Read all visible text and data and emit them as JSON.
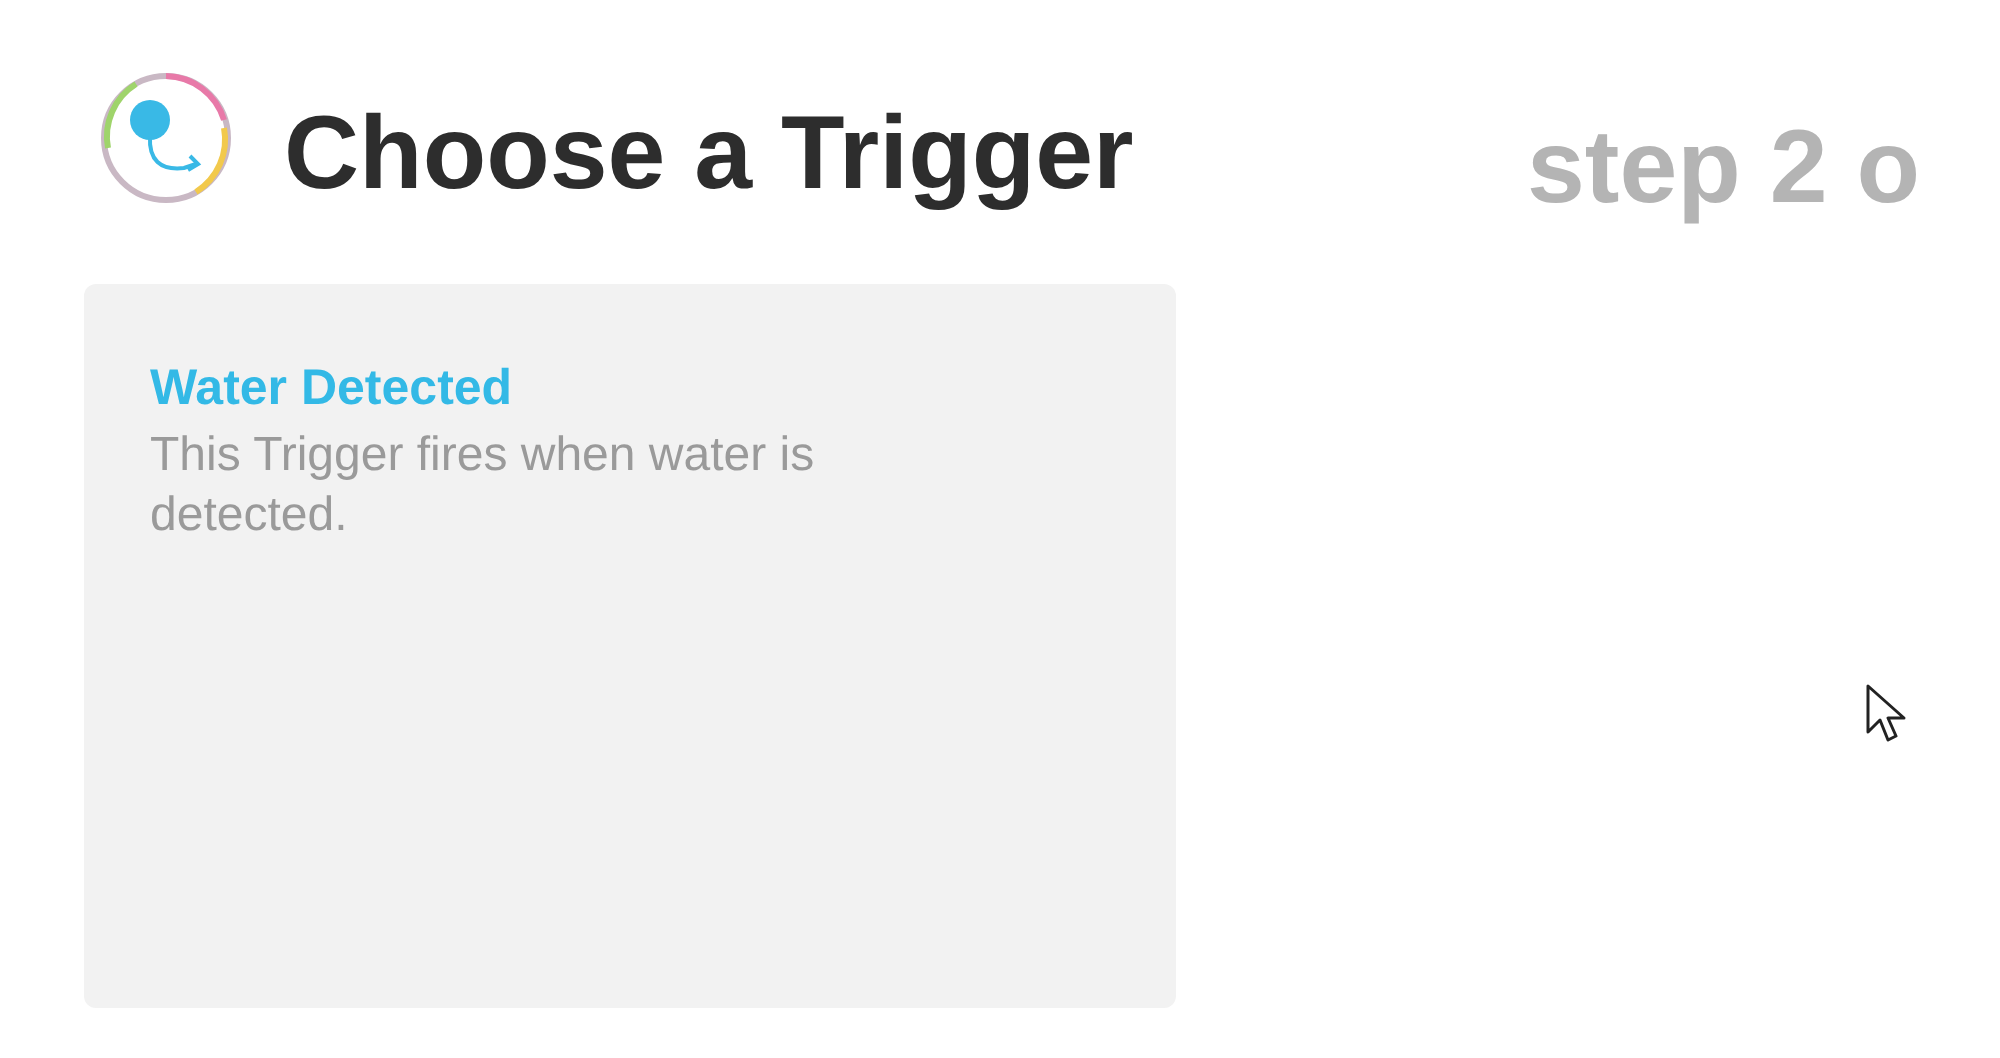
{
  "header": {
    "title": "Choose a Trigger",
    "step": "step 2 o"
  },
  "triggers": [
    {
      "name": "Water Detected",
      "description": "This Trigger fires when water is detected."
    }
  ]
}
